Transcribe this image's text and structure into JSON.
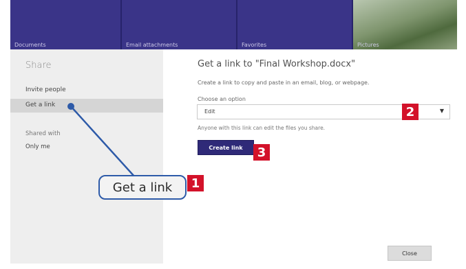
{
  "tiles": [
    {
      "label": "Documents"
    },
    {
      "label": "Email attachments"
    },
    {
      "label": "Favorites"
    },
    {
      "label": "Pictures"
    }
  ],
  "left_pane": {
    "title": "Share",
    "items": [
      {
        "label": "Invite people"
      },
      {
        "label": "Get a link"
      }
    ],
    "shared_with_label": "Shared with",
    "shared_with_value": "Only me"
  },
  "main": {
    "title": "Get a link to \"Final Workshop.docx\"",
    "description": "Create a link to copy and paste in an email, blog, or webpage.",
    "choose_label": "Choose an option",
    "select_value": "Edit",
    "select_hint": "Anyone with this link can edit the files you share.",
    "create_button": "Create link",
    "close_button": "Close"
  },
  "callout": {
    "text": "Get a link"
  },
  "badges": {
    "one": "1",
    "two": "2",
    "three": "3"
  },
  "colors": {
    "accent": "#2f2a78",
    "badge": "#d3122a",
    "callout_line": "#2d5aa8"
  }
}
